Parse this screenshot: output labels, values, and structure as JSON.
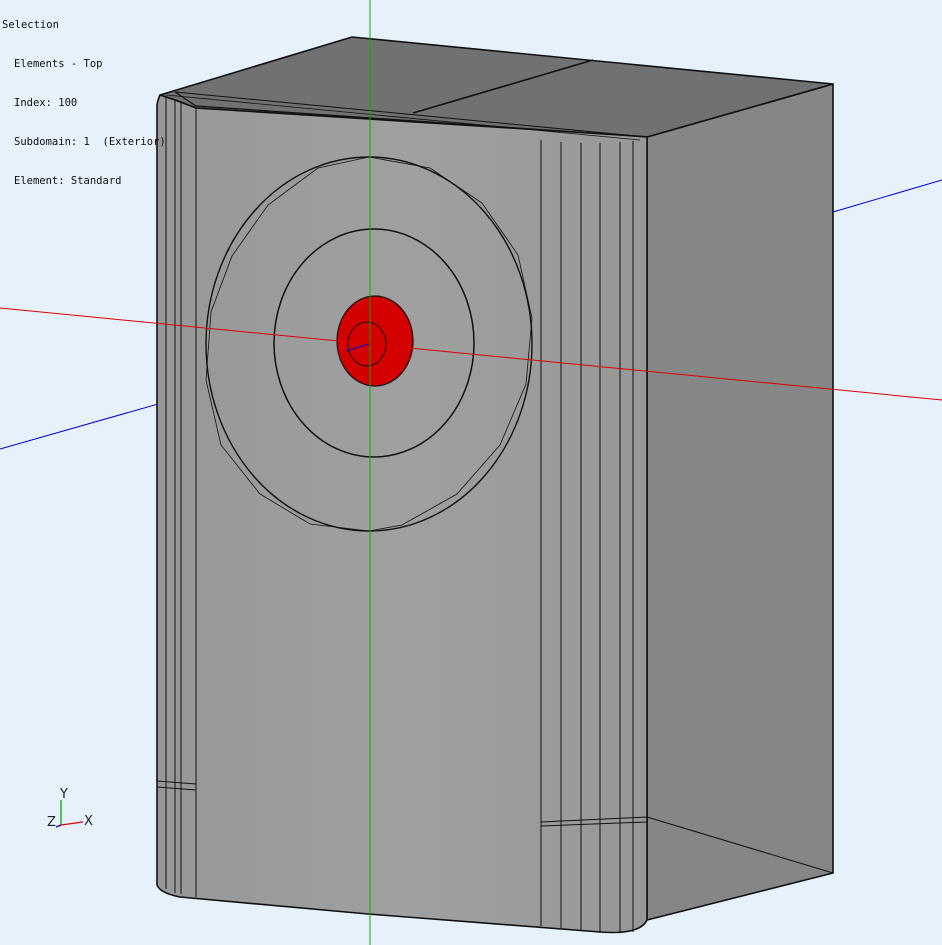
{
  "selection": {
    "header": "Selection",
    "lines": [
      "Elements - Top",
      "Index: 100",
      "Subdomain: 1  (Exterior)",
      "Element: Standard"
    ]
  },
  "triad": {
    "y": "Y",
    "z": "Z",
    "x": "X"
  },
  "colors": {
    "background": "#e6f1fb",
    "selected_element": "#d40000",
    "x_axis": "#e00000",
    "y_axis": "#00b000",
    "z_axis": "#0000d0",
    "front_face": "#9a9a9a",
    "side_face": "#868686",
    "top_face": "#707070"
  }
}
